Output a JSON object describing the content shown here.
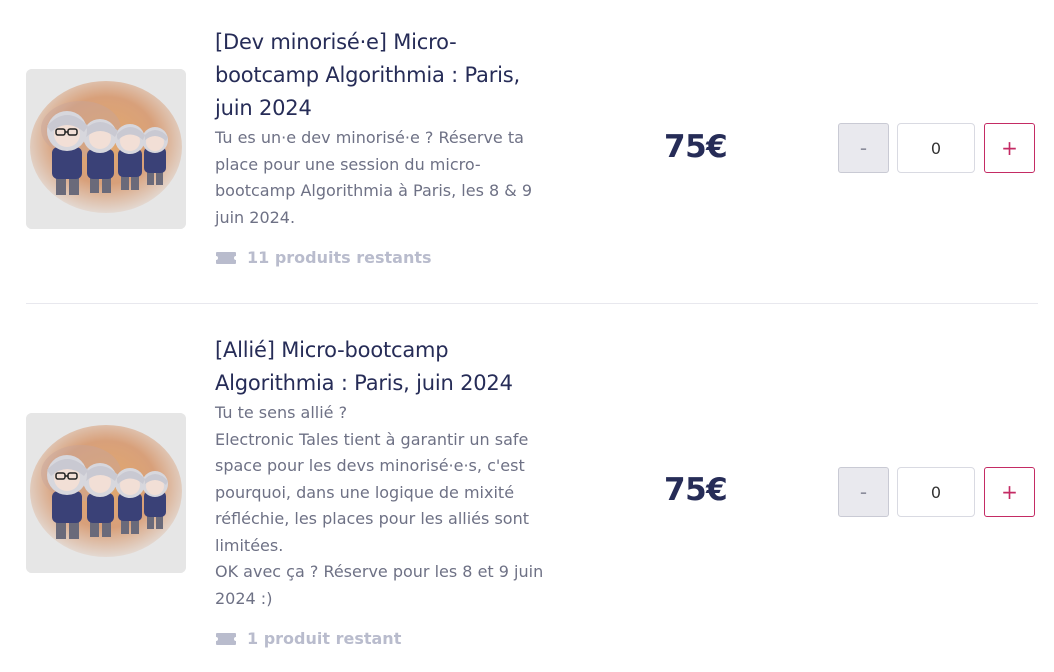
{
  "products": [
    {
      "title": "[Dev minorisé·e] Micro-bootcamp Algorithmia : Paris, juin 2024",
      "description": "Tu es un·e dev minorisé·e ? Réserve ta place pour une session du micro-bootcamp Algorithmia à Paris, les 8 & 9 juin 2024.",
      "stock": "11 produits restants",
      "price": "75€",
      "quantity": "0",
      "minus_label": "-",
      "plus_label": "+",
      "image_icon": "dolls-illustration"
    },
    {
      "title": "[Allié] Micro-bootcamp Algorithmia : Paris, juin 2024",
      "description": "Tu te sens allié ?\nElectronic Tales tient à garantir un safe space pour les devs minorisé·e·s, c'est pourquoi, dans une logique de mixité réfléchie, les places pour les alliés sont limitées.\nOK avec ça ? Réserve pour les 8 et 9 juin 2024 :)",
      "stock": "1 produit restant",
      "price": "75€",
      "quantity": "0",
      "minus_label": "-",
      "plus_label": "+",
      "image_icon": "dolls-illustration"
    }
  ],
  "colors": {
    "title": "#262c57",
    "text": "#6e7185",
    "stock": "#b9bccd",
    "accent": "#c42b64"
  },
  "icons": {
    "stock": "ticket-icon"
  }
}
